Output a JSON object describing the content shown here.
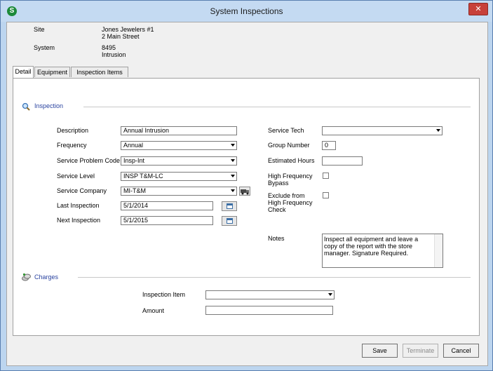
{
  "window": {
    "title": "System Inspections",
    "close_glyph": "✕",
    "app_icon_letter": "S"
  },
  "header": {
    "site_label": "Site",
    "site_name": "Jones Jewelers #1",
    "site_address": "2 Main Street",
    "system_label": "System",
    "system_number": "8495",
    "system_type": "Intrusion"
  },
  "tabs": [
    {
      "label": "Detail",
      "active": true
    },
    {
      "label": "Equipment",
      "active": false
    },
    {
      "label": "Inspection Items",
      "active": false
    }
  ],
  "inspection": {
    "section_title": "Inspection",
    "description": {
      "label": "Description",
      "value": "Annual Intrusion"
    },
    "frequency": {
      "label": "Frequency",
      "value": "Annual"
    },
    "service_problem_code": {
      "label": "Service Problem Code",
      "value": "Insp-Int"
    },
    "service_level": {
      "label": "Service Level",
      "value": "INSP T&M-LC"
    },
    "service_company": {
      "label": "Service Company",
      "value": "MI-T&M"
    },
    "last_inspection": {
      "label": "Last Inspection",
      "value": "5/1/2014"
    },
    "next_inspection": {
      "label": "Next Inspection",
      "value": "5/1/2015"
    },
    "service_tech": {
      "label": "Service Tech",
      "value": ""
    },
    "group_number": {
      "label": "Group Number",
      "value": "0"
    },
    "estimated_hours": {
      "label": "Estimated Hours",
      "value": ""
    },
    "high_frequency_bypass": {
      "label_line1": "High Frequency",
      "label_line2": "Bypass",
      "checked": false
    },
    "exclude_high_frequency": {
      "label_line1": "Exclude from",
      "label_line2": "High Frequency",
      "label_line3": "Check",
      "checked": false
    },
    "notes": {
      "label": "Notes",
      "value": "Inspect all equipment and leave a copy of the report with the store manager. Signature Required."
    }
  },
  "charges": {
    "section_title": "Charges",
    "inspection_item": {
      "label": "Inspection Item",
      "value": ""
    },
    "amount": {
      "label": "Amount",
      "value": ""
    }
  },
  "buttons": {
    "save": "Save",
    "terminate": "Terminate",
    "cancel": "Cancel"
  }
}
